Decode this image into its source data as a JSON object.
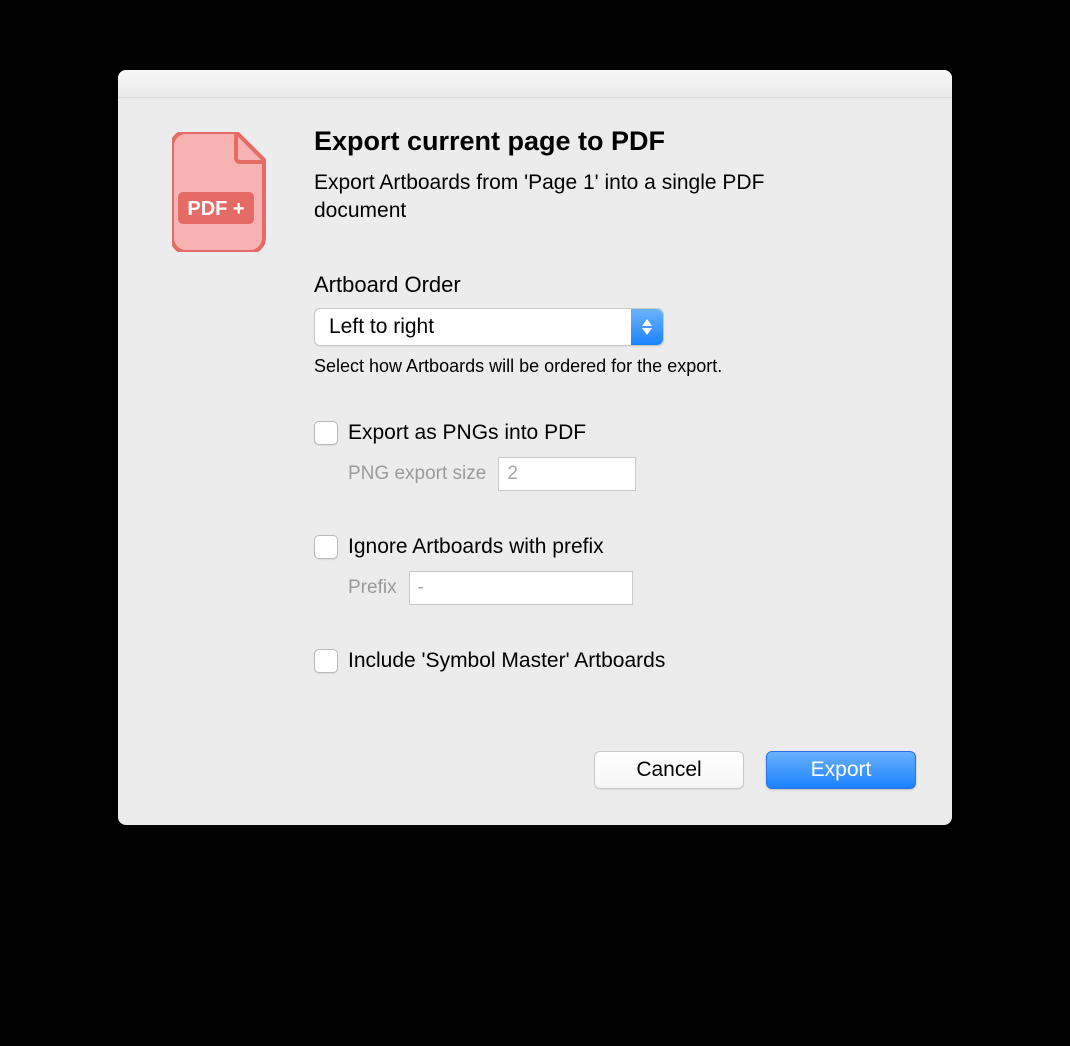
{
  "dialog": {
    "title": "Export current page to PDF",
    "description": "Export Artboards from 'Page 1' into a single PDF document",
    "icon_label": "PDF +"
  },
  "artboard_order": {
    "label": "Artboard Order",
    "selected": "Left to right",
    "hint": "Select how Artboards will be ordered for the export."
  },
  "options": {
    "export_pngs": {
      "label": "Export as PNGs into PDF",
      "checked": false,
      "sub_label": "PNG export size",
      "value": "2"
    },
    "ignore_prefix": {
      "label": "Ignore Artboards with prefix",
      "checked": false,
      "sub_label": "Prefix",
      "value": "-"
    },
    "include_symbol_master": {
      "label": "Include 'Symbol Master' Artboards",
      "checked": false
    }
  },
  "buttons": {
    "cancel": "Cancel",
    "export": "Export"
  }
}
